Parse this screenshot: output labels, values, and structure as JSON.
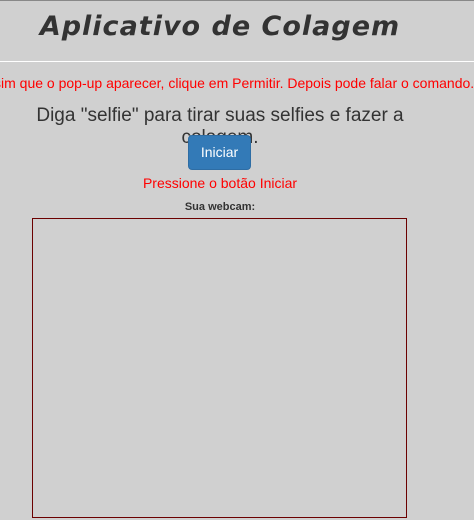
{
  "header": {
    "title": "Aplicativo de Colagem"
  },
  "instructions": {
    "permission_text": "sim que o pop-up aparecer, clique em Permitir. Depois pode falar o comando.",
    "voice_text": "Diga \"selfie\" para tirar suas selfies e fazer a colagem."
  },
  "controls": {
    "start_label": "Iniciar",
    "status_text": "Pressione o botão Iniciar"
  },
  "webcam": {
    "label": "Sua webcam:"
  }
}
